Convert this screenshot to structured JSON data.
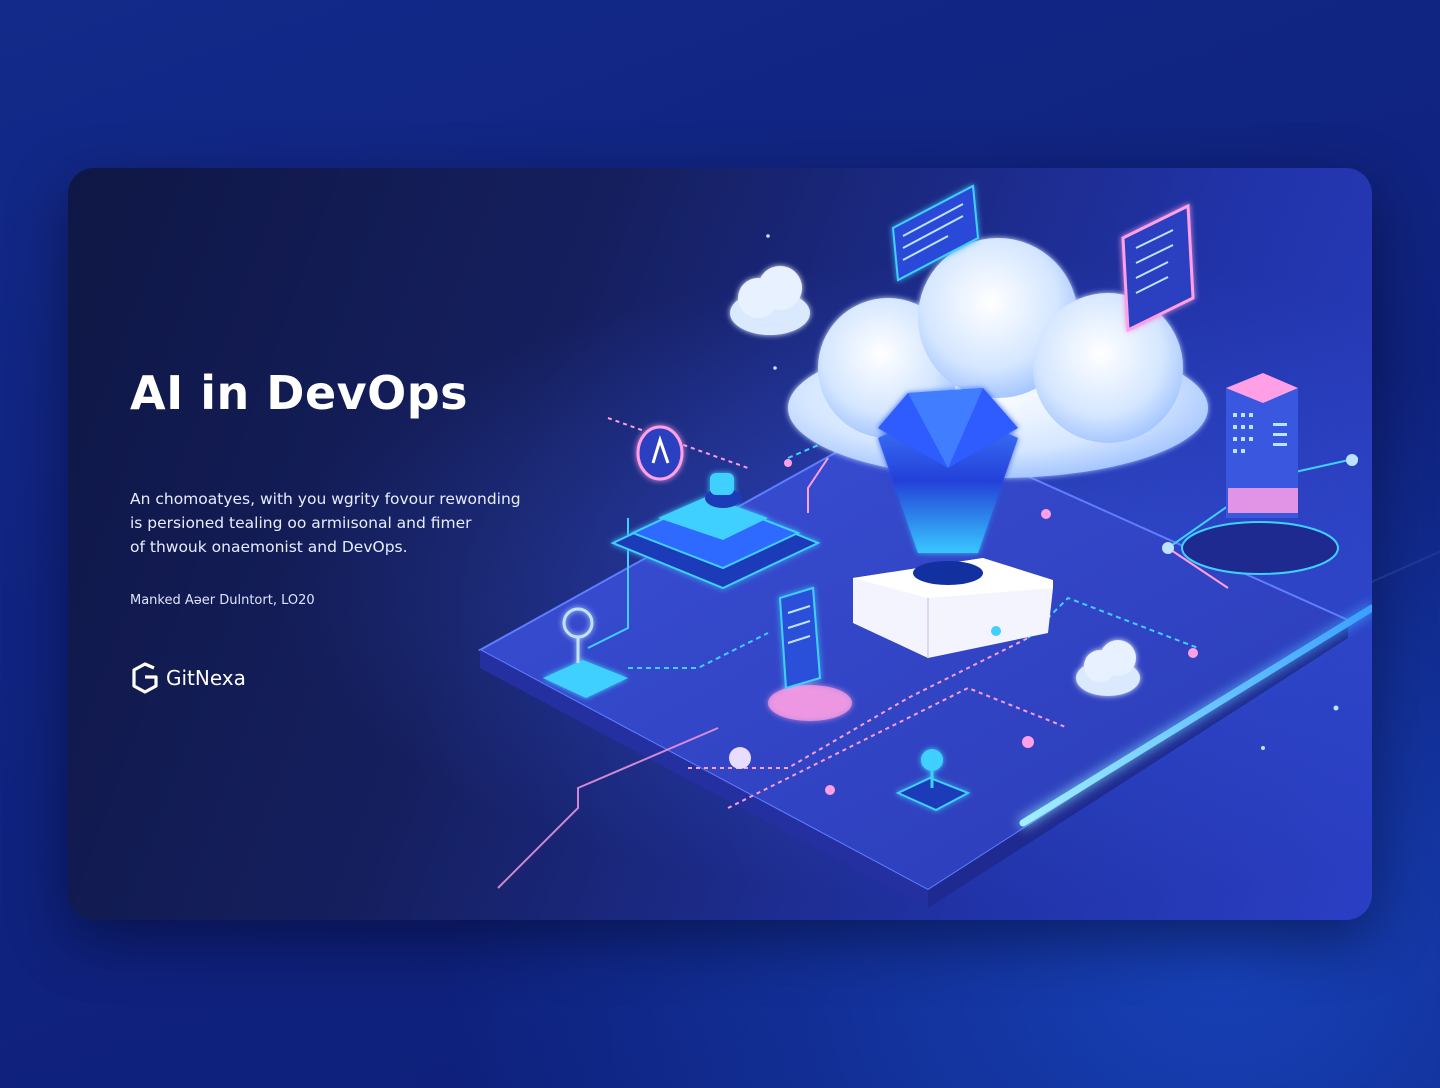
{
  "hero": {
    "title": "AI in DevOps",
    "description_lines": [
      "An chomoatyes, with you wgrity fovour rewonding",
      "is persioned tealing oo armiısonal and fimer",
      "of thwouk onaemonist and DevOps."
    ],
    "meta": "Manked Aǝer Dulntort, LO20",
    "brand": "GitNexa"
  },
  "icons": [
    "gitnexa-logo-icon",
    "cloud-icon",
    "gem-icon",
    "server-rack-icon",
    "mobile-phone-icon",
    "document-panel-icon",
    "chip-node-icon"
  ],
  "colors": {
    "accent_cyan": "#3fd0ff",
    "accent_pink": "#ff9fe6",
    "accent_blue": "#2f55ff"
  }
}
